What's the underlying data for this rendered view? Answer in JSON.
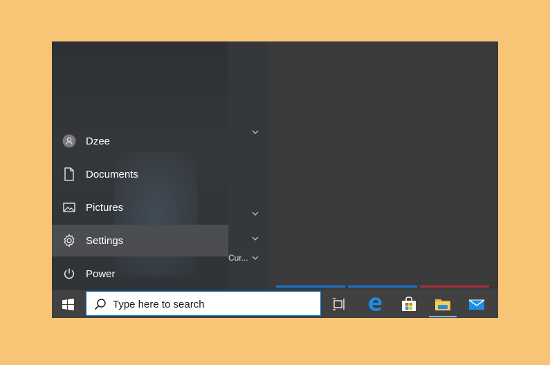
{
  "start_menu": {
    "items": [
      {
        "label": "Dzee",
        "icon": "user-avatar-icon"
      },
      {
        "label": "Documents",
        "icon": "document-icon"
      },
      {
        "label": "Pictures",
        "icon": "pictures-icon"
      },
      {
        "label": "Settings",
        "icon": "gear-icon"
      },
      {
        "label": "Power",
        "icon": "power-icon"
      }
    ],
    "list_fragment": "Cur...",
    "colors": {
      "tile_blue": "#1976c9",
      "tile_red": "#a3303a",
      "highlight": "#4b4d50"
    }
  },
  "taskbar": {
    "search_placeholder": "Type here to search",
    "apps": [
      "task-view-icon",
      "edge-icon",
      "store-icon",
      "file-explorer-icon",
      "mail-icon"
    ]
  }
}
